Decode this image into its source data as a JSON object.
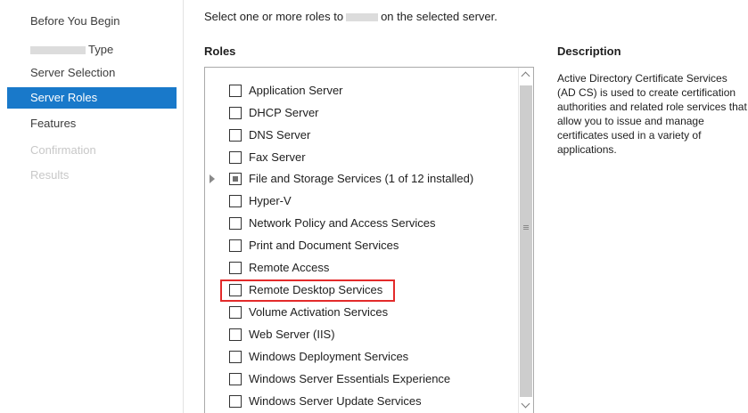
{
  "sidebar": {
    "items": [
      {
        "label": "Before You Begin",
        "state": "normal"
      },
      {
        "label": "Type",
        "state": "normal",
        "redacted_prefix": true
      },
      {
        "label": "Server Selection",
        "state": "normal"
      },
      {
        "label": "Server Roles",
        "state": "active"
      },
      {
        "label": "Features",
        "state": "normal"
      },
      {
        "label": "Confirmation",
        "state": "disabled"
      },
      {
        "label": "Results",
        "state": "disabled"
      }
    ]
  },
  "main": {
    "instruction_before": "Select one or more roles to",
    "instruction_after": "on the selected server.",
    "roles_header": "Roles",
    "description_header": "Description",
    "description_text": "Active Directory Certificate Services (AD CS) is used to create certification authorities and related role services that allow you to issue and manage certificates used in a variety of applications."
  },
  "roles": [
    {
      "label": "Application Server",
      "state": "unchecked",
      "expandable": false
    },
    {
      "label": "DHCP Server",
      "state": "unchecked",
      "expandable": false
    },
    {
      "label": "DNS Server",
      "state": "unchecked",
      "expandable": false
    },
    {
      "label": "Fax Server",
      "state": "unchecked",
      "expandable": false
    },
    {
      "label": "File and Storage Services (1 of 12 installed)",
      "state": "partial",
      "expandable": true
    },
    {
      "label": "Hyper-V",
      "state": "unchecked",
      "expandable": false
    },
    {
      "label": "Network Policy and Access Services",
      "state": "unchecked",
      "expandable": false
    },
    {
      "label": "Print and Document Services",
      "state": "unchecked",
      "expandable": false
    },
    {
      "label": "Remote Access",
      "state": "unchecked",
      "expandable": false
    },
    {
      "label": "Remote Desktop Services",
      "state": "unchecked",
      "expandable": false,
      "highlighted": true
    },
    {
      "label": "Volume Activation Services",
      "state": "unchecked",
      "expandable": false
    },
    {
      "label": "Web Server (IIS)",
      "state": "unchecked",
      "expandable": false
    },
    {
      "label": "Windows Deployment Services",
      "state": "unchecked",
      "expandable": false
    },
    {
      "label": "Windows Server Essentials Experience",
      "state": "unchecked",
      "expandable": false
    },
    {
      "label": "Windows Server Update Services",
      "state": "unchecked",
      "expandable": false
    }
  ],
  "colors": {
    "active_nav": "#1979ca",
    "highlight_border": "#e32a2a",
    "disabled_text": "#c8c8c8"
  }
}
